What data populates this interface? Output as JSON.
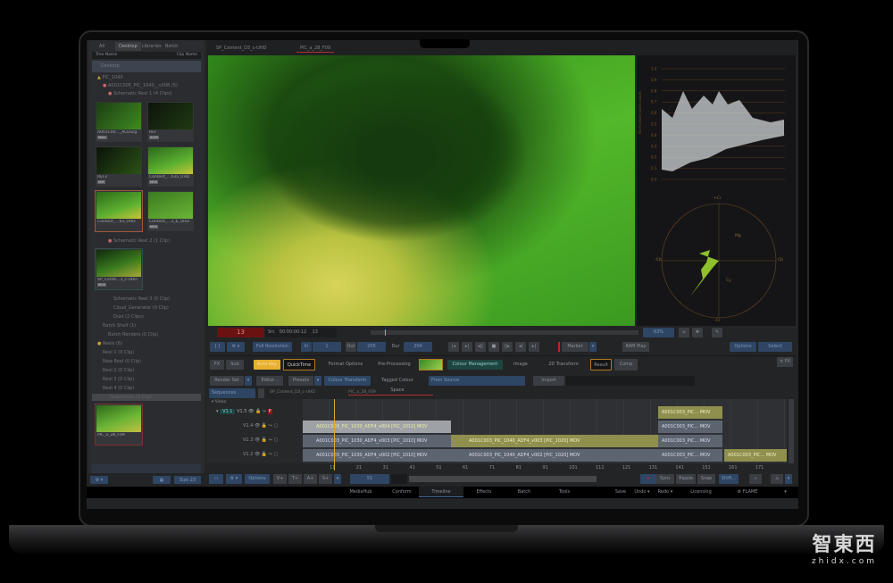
{
  "library": {
    "tabs": [
      "All",
      "Desktop",
      "Libraries",
      "Batch"
    ],
    "col_tree": "Tree Name",
    "col_clip": "Clip Name",
    "desktop": "Desktop",
    "project": "PIC_1040",
    "reel_group": "A001C005_PIC_1040__v008 (5)",
    "schematic1": "Schematic Reel 1 (4 Clips)",
    "thumbs1": [
      {
        "label": "A001C00..._ACEScg",
        "badge": "Multi"
      },
      {
        "label": "REF",
        "badge": "ACES"
      },
      {
        "label": "REF2",
        "badge": "MXF"
      },
      {
        "label": "Content_...03a_UHD",
        "badge": "MOV"
      },
      {
        "label": "Content_...03_UHD",
        "badge": ""
      },
      {
        "label": "Content_...3_b_UHD",
        "badge": "MOV"
      }
    ],
    "schematic2": "Schematic Reel 2 (1 Clip)",
    "thumb2": {
      "label": "SP_Conte...3_c-UHD",
      "badge": "MOV"
    },
    "items": [
      "Schematic Reel 3 (0 Clip)",
      "Cloud_Generator (0 Clip)",
      "Dust (2 Clips)",
      "Batch Shelf (1)",
      "Batch Renders (0 Clip)",
      "Reels (6)",
      "Reel 1 (0 Clip)",
      "New Reel (0 Clip)",
      "Reel 2 (0 Clip)",
      "Reel 3 (0 Clip)",
      "Reel 4 (0 Clip)",
      "Sequences (1 Clip)"
    ],
    "thumb3": {
      "label": "PIC_a_28_F09"
    },
    "size_label": "Size 23"
  },
  "viewer": {
    "tabs": [
      "SP_Content_D3_c-UHD",
      "PIC_a_28_F09"
    ],
    "frame": "13",
    "src_label": "Src",
    "timecode": "00:00:00:12",
    "src_frame": "13",
    "zoom": "63%",
    "resolution": "Full Resolution",
    "in_label": "In",
    "in_value": "1",
    "out_label": "Out",
    "out_value": "205",
    "dur_label": "Dur",
    "dur_value": "204",
    "marker": "Marker",
    "ram_play": "RAM Play",
    "options": "Options",
    "select": "Select"
  },
  "scopes": {
    "waveform_ylabel": "Normalized pixel values",
    "waveform_ticks": [
      "1.0",
      "0.9",
      "0.8",
      "0.7",
      "0.6",
      "0.5",
      "0.4",
      "0.3",
      "0.2",
      "0.1",
      "0.0"
    ],
    "vector_labels": {
      "top": "+Cr",
      "bottom": "-Cr",
      "left": "-Cb",
      "right": "Cb",
      "mg": "Mg",
      "cy": "Cy"
    }
  },
  "fx": {
    "fx": "FX",
    "sub": "Sub",
    "auto_key": "Auto Key",
    "quicktime": "QuickTime",
    "format_options": "Format Options",
    "pre_processing": "Pre-Processing",
    "colour_management": "Colour Management",
    "image": "Image",
    "transform": "2D Transform",
    "result": "Result",
    "comp": "Comp",
    "fx_toggle": "± FX",
    "render_set": "Render Set",
    "editor": "Editor...",
    "presets": "Presets",
    "colour_transform": "Colour Transform",
    "tagged_label": "Tagged Colour Space",
    "tagged_value": "From Source",
    "import": "Import"
  },
  "timeline": {
    "sequences": "Sequences",
    "seq_tabs": [
      "SP_Content_D3_c-UHD",
      "PIC_a_28_F09"
    ],
    "video_label": "Video",
    "tracks": [
      "V1.5",
      "V1.4",
      "V1.3",
      "V1.2"
    ],
    "active_track": "V1.1",
    "clips": {
      "v14": "A001C003_PIC_1030_ADF4_v004 [PIC_1010]",
      "v13a": "A001C003_PIC_1030_ADF4_v003 [PIC_1010]",
      "v12a": "A001C003_PIC_1030_ADF4_v002 [PIC_1010]",
      "v13b": "A001C003_PIC_1040_ADF4_v003 [PIC_1020]",
      "v12b": "A001C003_PIC_1040_ADF4_v002 [PIC_1020]",
      "short": "A001C003_PIC..."
    },
    "mov": "MOV",
    "ruler": [
      "11",
      "21",
      "31",
      "41",
      "51",
      "61",
      "71",
      "81",
      "91",
      "101",
      "111",
      "121",
      "131",
      "141",
      "151",
      "161",
      "171"
    ],
    "toolbar": {
      "options": "Options",
      "v": "V+",
      "t": "T+",
      "a": "A+",
      "s": "S+",
      "frame": "51",
      "sync": "Sync",
      "ripple": "Ripple",
      "snap": "Snap",
      "shift": "Shift..."
    }
  },
  "bottom": {
    "tabs": [
      "MediaHub",
      "Conform",
      "Timeline",
      "Effects",
      "Batch",
      "Tools"
    ],
    "active": "Timeline",
    "save": "Save",
    "undo": "Undo",
    "redo": "Redo",
    "licensing": "Licensing",
    "brand": "FLAME"
  },
  "watermark": {
    "cn": "智東西",
    "en": "zhidx.com"
  }
}
